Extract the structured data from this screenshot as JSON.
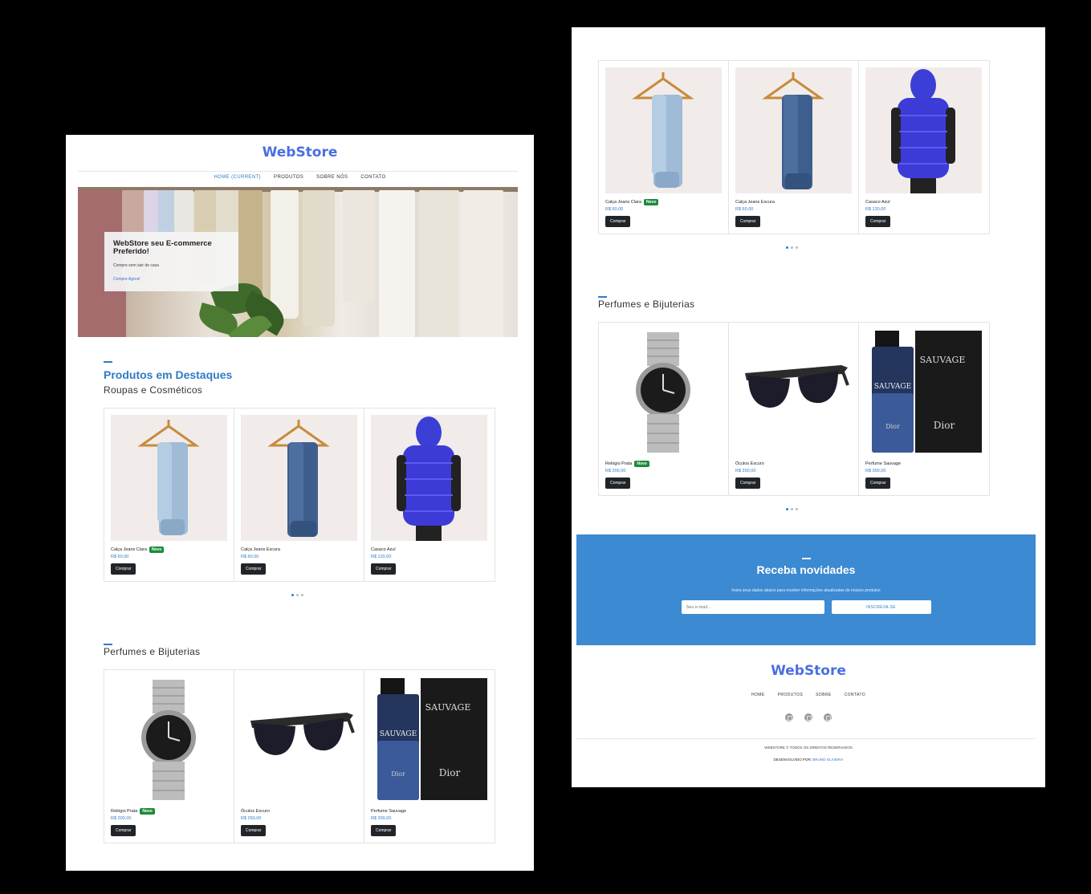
{
  "brand": "WebStore",
  "nav": {
    "home": "HOME (CURRENT)",
    "produtos": "PRODUTOS",
    "sobre": "SOBRE NÓS",
    "contato": "CONTATO"
  },
  "hero": {
    "title": "WebStore seu E-commerce Preferido!",
    "text": "Compre sem sair de casa",
    "link": "Compre Agora!"
  },
  "featured": {
    "title": "Produtos em Destaques",
    "subtitle": "Roupas e Cosméticos",
    "products": [
      {
        "name": "Calça Jeans Clara",
        "price": "R$ 60,00",
        "badge": "Novo",
        "button": "Comprar",
        "image": "light-jeans-on-hanger"
      },
      {
        "name": "Calça Jeans Escura",
        "price": "R$ 60,00",
        "badge": "",
        "button": "Comprar",
        "image": "dark-jeans-on-hanger"
      },
      {
        "name": "Casaco Azul",
        "price": "R$ 120,00",
        "badge": "",
        "button": "Comprar",
        "image": "blue-puffer-vest"
      }
    ]
  },
  "perfumes": {
    "title": "Perfumes e Bijuterias",
    "products": [
      {
        "name": "Relógio Prata",
        "price": "R$ 200,00",
        "badge": "Novo",
        "button": "Comprar",
        "image": "silver-watch"
      },
      {
        "name": "Óculos Escuro",
        "price": "R$ 250,00",
        "badge": "",
        "button": "Comprar",
        "image": "black-sunglasses"
      },
      {
        "name": "Perfume Sauvage",
        "price": "R$ 300,00",
        "badge": "",
        "button": "Comprar",
        "image": "sauvage-perfume"
      }
    ],
    "box_text": "SAUVAGE",
    "bottle_text": "SAUVAGE",
    "maker": "Dior"
  },
  "newsletter": {
    "title": "Receba novidades",
    "text": "Insira seus dados abaixo para receber informações atualizadas de nossos produtos",
    "placeholder": "Seu e-mail...",
    "button": "INSCREVA-SE"
  },
  "footer": {
    "nav": [
      "HOME",
      "PRODUTOS",
      "SOBRE",
      "CONTATO"
    ],
    "social_icons": [
      "instagram-icon",
      "linkedin-icon",
      "github-icon"
    ],
    "copyright": "WEBSTORE © TODOS OS DIREITOS RESERVADOS",
    "dev_label": "DESENVOLVIDO POR:",
    "dev_name": "BRUNO OLIVEIRA"
  },
  "colors": {
    "brand": "#4a6fe3",
    "accent": "#2f7bc4",
    "newsletter_bg": "#3c8ad1",
    "badge": "#1b8a3b",
    "button": "#212529"
  }
}
